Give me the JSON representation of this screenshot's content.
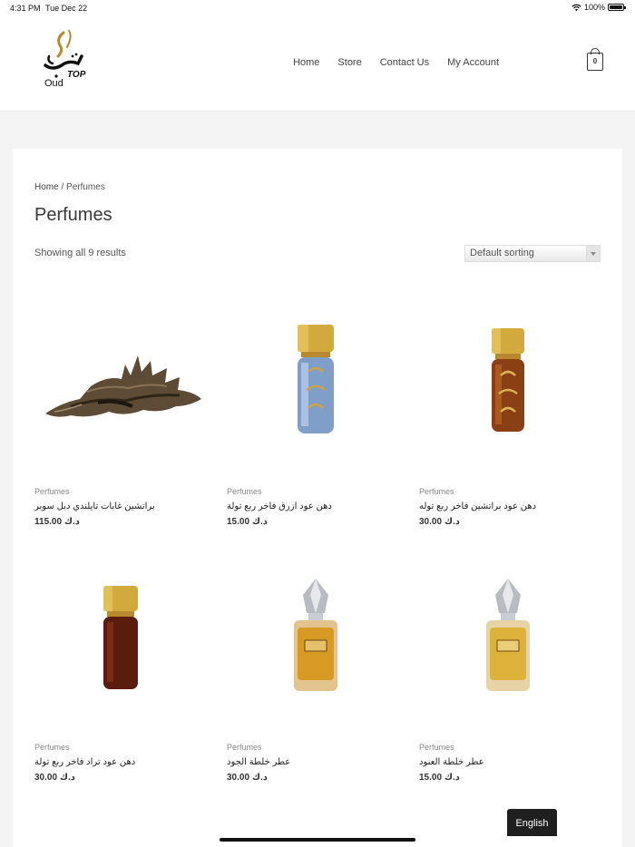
{
  "status": {
    "time": "4:31 PM",
    "date": "Tue Dec 22",
    "battery": "100%"
  },
  "brand": {
    "arabic": "توب",
    "latin_top": "TOP",
    "latin_oud": "Oud"
  },
  "nav": {
    "items": [
      "Home",
      "Store",
      "Contact Us",
      "My Account"
    ],
    "cart_count": "0"
  },
  "page": {
    "breadcrumb_home": "Home",
    "breadcrumb_sep": " / ",
    "breadcrumb_current": "Perfumes",
    "title": "Perfumes",
    "results": "Showing all 9 results",
    "sort_selected": "Default sorting"
  },
  "products": [
    {
      "category": "Perfumes",
      "name": "براتشين غابات تايلندي دبل سوبر",
      "price": "115.00 د.ك",
      "image": "agarwood-chip"
    },
    {
      "category": "Perfumes",
      "name": "دهن عود ازرق فاخر ربع تولة",
      "price": "15.00 د.ك",
      "image": "blue-oil-bottle"
    },
    {
      "category": "Perfumes",
      "name": "دهن عود براتشين فاخر ربع توله",
      "price": "30.00 د.ك",
      "image": "amber-oil-bottle"
    },
    {
      "category": "Perfumes",
      "name": "دهن عود تراد فاخر ربع تولة",
      "price": "30.00 د.ك",
      "image": "dark-oil-bottle"
    },
    {
      "category": "Perfumes",
      "name": "عطر خلطة الجود",
      "price": "30.00 د.ك",
      "image": "perfume-bottle"
    },
    {
      "category": "Perfumes",
      "name": "عطر خلطة العنود",
      "price": "15.00 د.ك",
      "image": "perfume-bottle"
    }
  ],
  "language": "English",
  "colors": {
    "gold": "#c9a23a",
    "accent": "#1f1f1f",
    "background": "#f4f4f4"
  }
}
